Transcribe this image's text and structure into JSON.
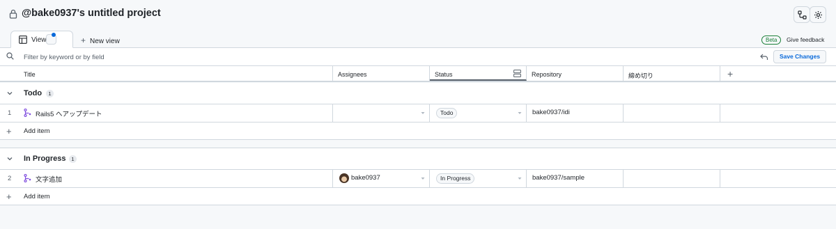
{
  "header": {
    "title": "@bake0937's untitled project",
    "icons": {
      "lock": "lock-icon",
      "workflows": "workflow-icon",
      "settings": "gear-icon"
    }
  },
  "tabs": {
    "active_label": "View 1",
    "new_view_label": "New view",
    "beta_label": "Beta",
    "feedback_label": "Give feedback"
  },
  "filter": {
    "placeholder": "Filter by keyword or by field",
    "save_label": "Save Changes"
  },
  "columns": {
    "title": "Title",
    "assignees": "Assignees",
    "status": "Status",
    "repository": "Repository",
    "deadline": "締め切り"
  },
  "groups": [
    {
      "name": "Todo",
      "count": "1",
      "items": [
        {
          "num": "1",
          "title": "Rails5 へアップデート",
          "assignee": "",
          "status": "Todo",
          "repository": "bake0937/idi"
        }
      ],
      "add_label": "Add item"
    },
    {
      "name": "In Progress",
      "count": "1",
      "items": [
        {
          "num": "2",
          "title": "文字追加",
          "assignee": "bake0937",
          "status": "In Progress",
          "repository": "bake0937/sample"
        }
      ],
      "add_label": "Add item"
    }
  ],
  "colors": {
    "accent": "#0969da",
    "beta_green": "#1a7f37",
    "pr_purple": "#8250df"
  }
}
